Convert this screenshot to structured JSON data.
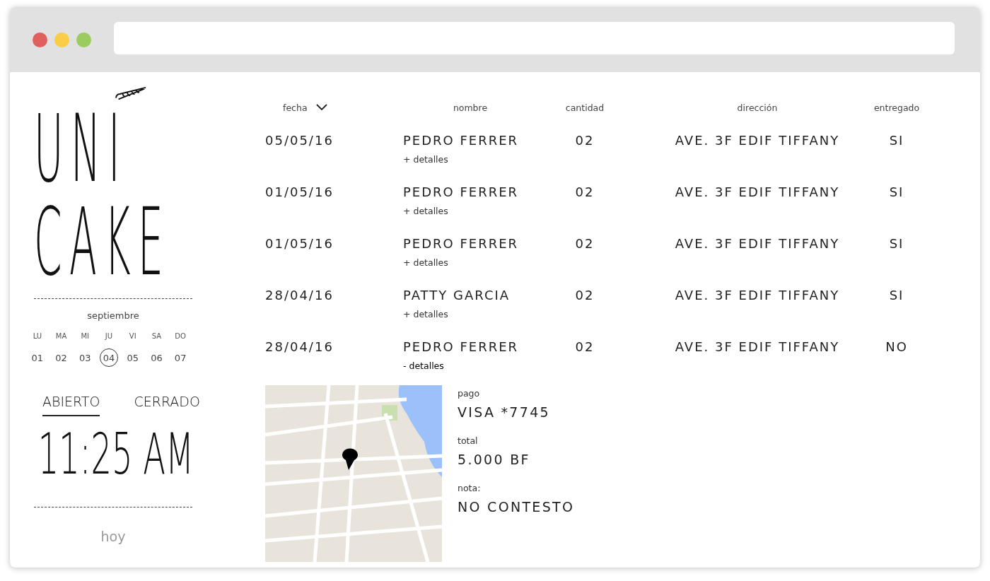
{
  "sidebar": {
    "logo": {
      "line_1": "UNI",
      "line_2": "CAKE"
    },
    "calendar": {
      "month": "septiembre",
      "days": [
        {
          "weekday": "LU",
          "date": "01",
          "selected": false
        },
        {
          "weekday": "MA",
          "date": "02",
          "selected": false
        },
        {
          "weekday": "MI",
          "date": "03",
          "selected": false
        },
        {
          "weekday": "JU",
          "date": "04",
          "selected": true
        },
        {
          "weekday": "VI",
          "date": "05",
          "selected": false
        },
        {
          "weekday": "SA",
          "date": "06",
          "selected": false
        },
        {
          "weekday": "DO",
          "date": "07",
          "selected": false
        }
      ]
    },
    "status_tabs": [
      {
        "label": "ABIERTO",
        "selected": true
      },
      {
        "label": "CERRADO",
        "selected": false
      }
    ],
    "time": "11:25 AM",
    "today_link": "hoy"
  },
  "orders": {
    "columns": [
      {
        "label": "fecha",
        "sorted": true
      },
      {
        "label": "nombre",
        "sorted": false
      },
      {
        "label": "cantidad",
        "sorted": false
      },
      {
        "label": "dirección",
        "sorted": false
      },
      {
        "label": "entregado",
        "sorted": false
      }
    ],
    "rows": [
      {
        "date": "05/05/16",
        "name": "PEDRO FERRER",
        "details_link": "+ detalles",
        "quantity": "02",
        "address": "AVE. 3F EDIF TIFFANY",
        "delivered": "SI",
        "expanded": false
      },
      {
        "date": "01/05/16",
        "name": "PEDRO FERRER",
        "details_link": "+ detalles",
        "quantity": "02",
        "address": "AVE. 3F EDIF TIFFANY",
        "delivered": "SI",
        "expanded": false
      },
      {
        "date": "01/05/16",
        "name": "PEDRO FERRER",
        "details_link": "+ detalles",
        "quantity": "02",
        "address": "AVE. 3F EDIF TIFFANY",
        "delivered": "SI",
        "expanded": false
      },
      {
        "date": "28/04/16",
        "name": "PATTY GARCIA",
        "details_link": "+ detalles",
        "quantity": "02",
        "address": "AVE. 3F EDIF TIFFANY",
        "delivered": "SI",
        "expanded": false
      },
      {
        "date": "28/04/16",
        "name": "PEDRO FERRER",
        "details_link": "- detalles",
        "quantity": "02",
        "address": "AVE. 3F EDIF TIFFANY",
        "delivered": "NO",
        "expanded": true
      }
    ],
    "details": {
      "fields": [
        {
          "label": "pago",
          "value": "VISA *7745"
        },
        {
          "label": "total",
          "value": "5.000 BF"
        },
        {
          "label": "nota:",
          "value": "NO CONTESTO"
        }
      ]
    }
  }
}
